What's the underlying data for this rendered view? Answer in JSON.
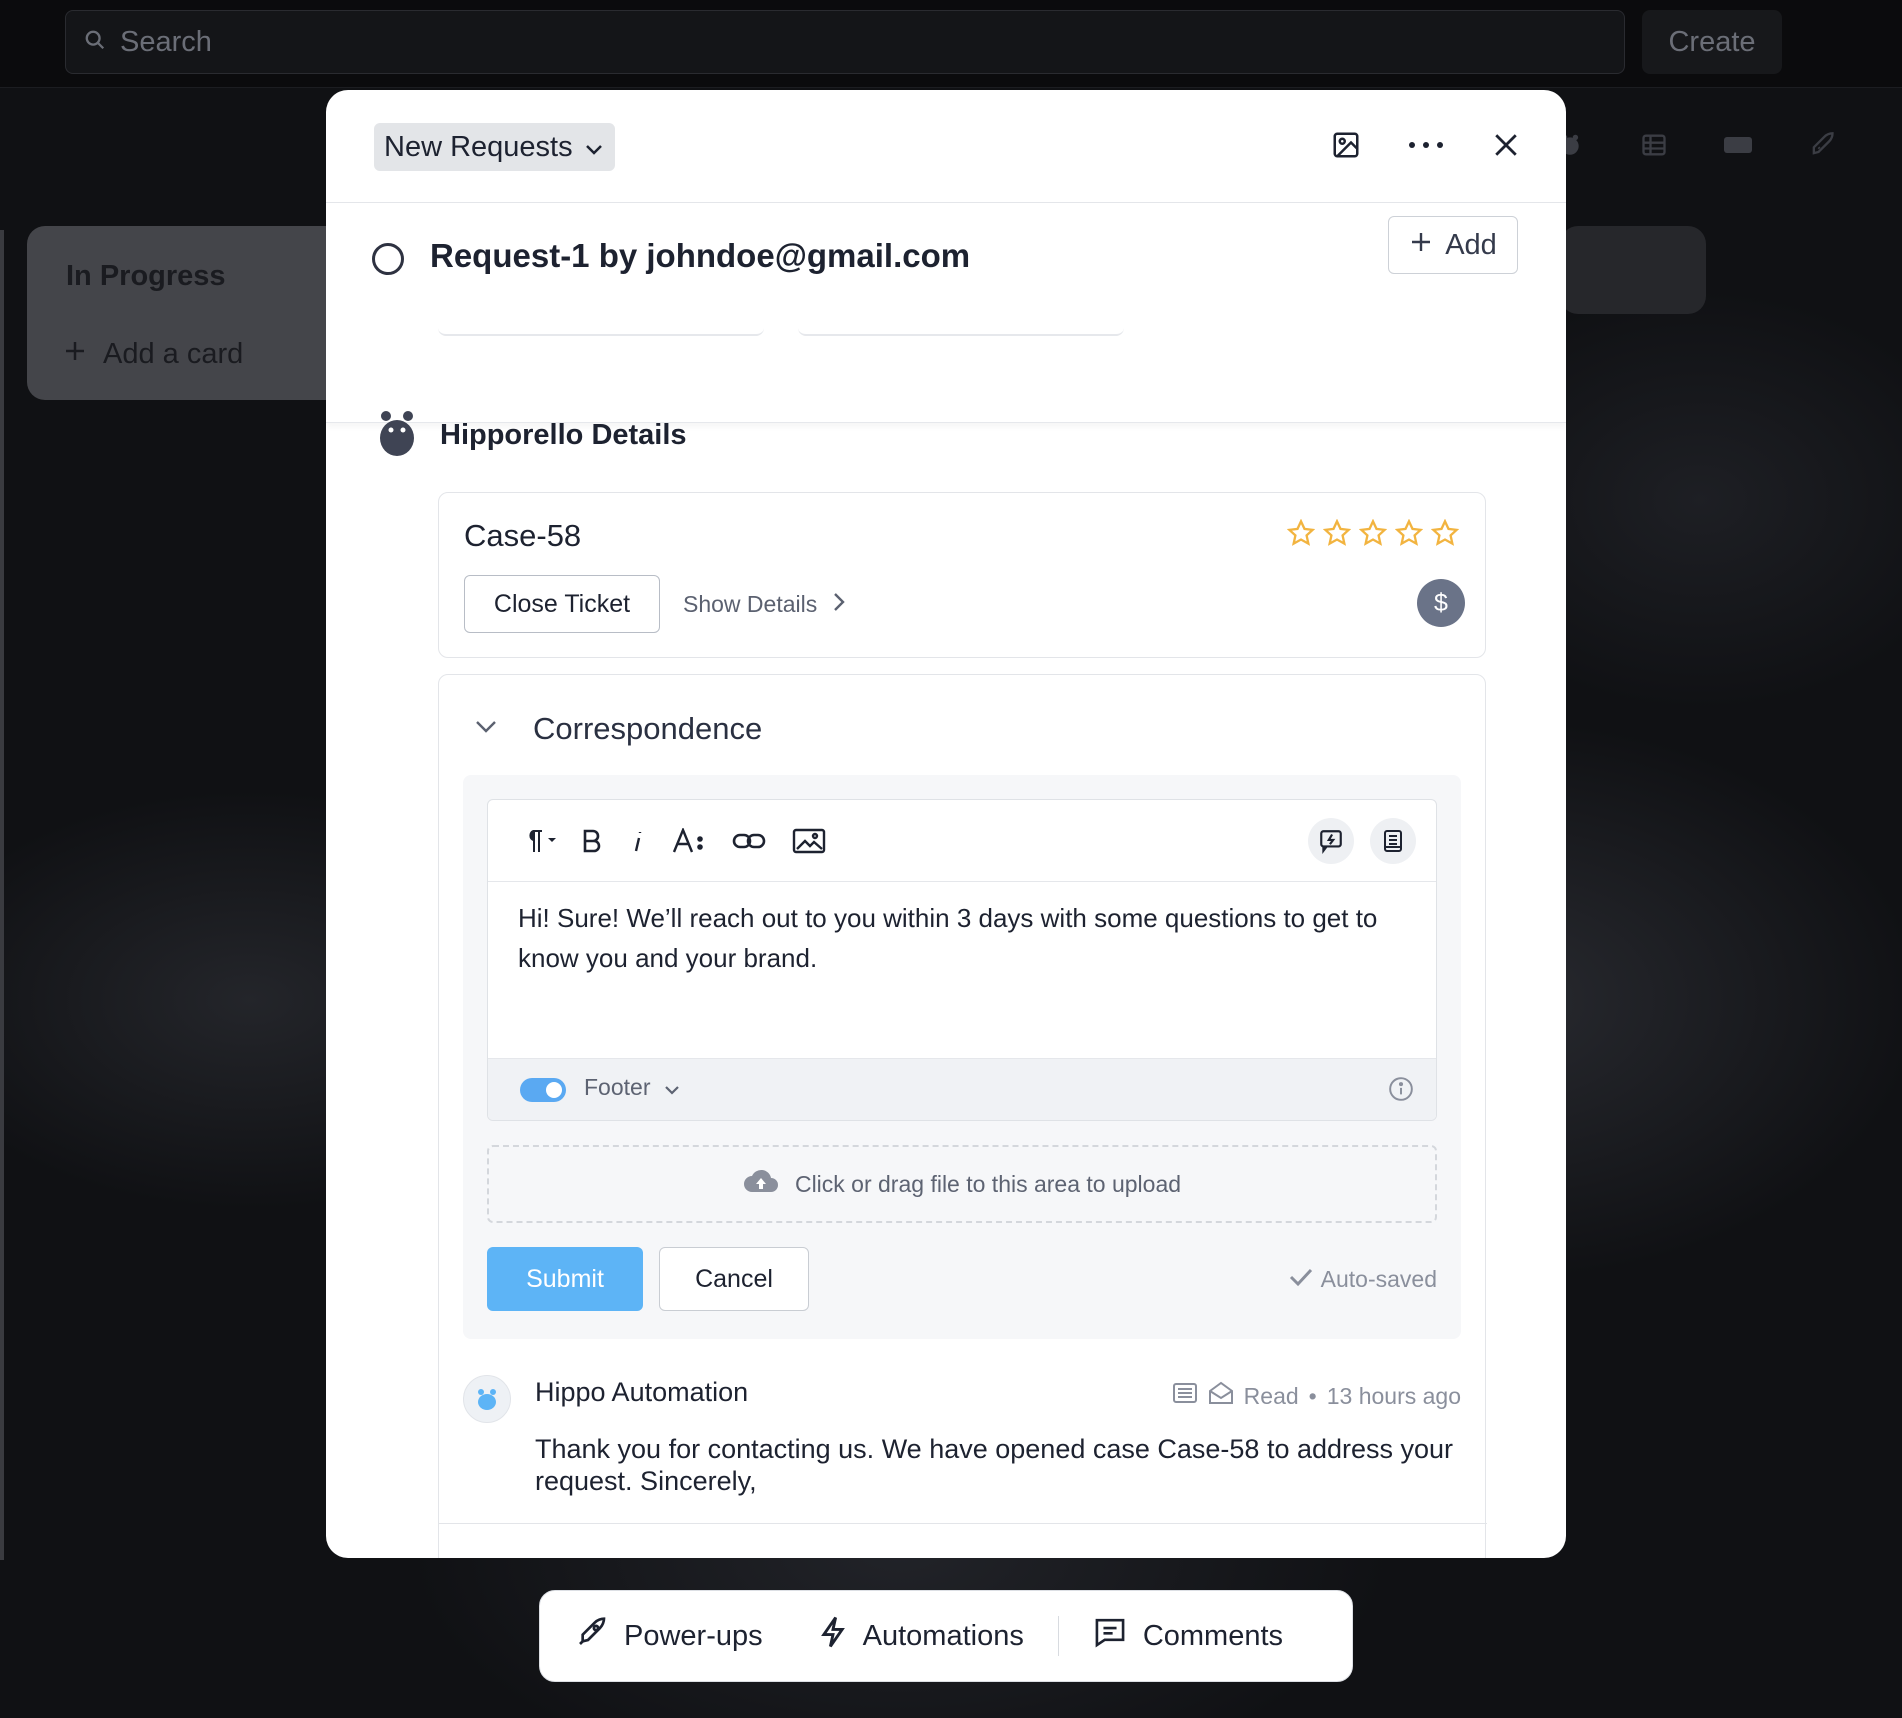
{
  "topbar": {
    "search_placeholder": "Search",
    "create_label": "Create"
  },
  "board": {
    "list_title": "In Progress",
    "add_card_label": "Add a card"
  },
  "modal": {
    "list_name": "New Requests",
    "card_title": "Request-1 by johndoe@gmail.com",
    "add_label": "Add",
    "powerup_section": "Hipporello Details",
    "case": {
      "name": "Case-58",
      "close_label": "Close Ticket",
      "details_label": "Show Details",
      "avatar_letter": "$",
      "rating": 0,
      "max_rating": 5
    },
    "correspondence": {
      "title": "Correspondence",
      "editor_text": "Hi! Sure! We’ll reach out to you within 3 days with some questions to get to know you and your brand.",
      "footer_label": "Footer",
      "footer_enabled": true,
      "upload_text": "Click or drag file to this area to upload",
      "submit_label": "Submit",
      "cancel_label": "Cancel",
      "autosave_label": "Auto-saved",
      "message": {
        "author": "Hippo Automation",
        "status": "Read",
        "time": "13 hours ago",
        "body": "Thank you for contacting us. We have opened case Case-58 to address your request. Sincerely,"
      }
    }
  },
  "dock": {
    "powerups_label": "Power-ups",
    "automations_label": "Automations",
    "comments_label": "Comments"
  },
  "colors": {
    "accent": "#5db4f6",
    "star": "#f2b440"
  }
}
